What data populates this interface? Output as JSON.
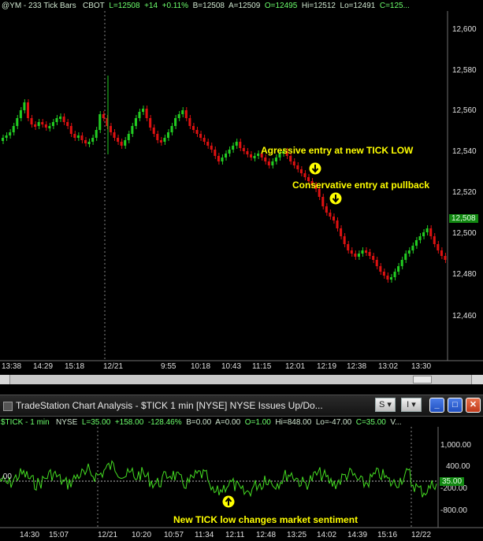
{
  "main_chart": {
    "info_bar": {
      "symbol": "@YM - 233 Tick Bars",
      "exchange": "CBOT",
      "last": "L=12508",
      "change": "+14",
      "pct": "+0.11%",
      "bid": "B=12508",
      "ask": "A=12509",
      "open": "O=12495",
      "high": "Hi=12512",
      "low": "Lo=12491",
      "close": "C=125..."
    },
    "y_axis_labels": [
      "12,600",
      "12,580",
      "12,560",
      "12,540",
      "12,520",
      "12,500",
      "12,480",
      "12,460"
    ],
    "x_axis_labels": [
      "13:38",
      "14:29",
      "15:18",
      "12/21",
      "9:55",
      "10:18",
      "10:43",
      "11:15",
      "12:01",
      "12:19",
      "12:38",
      "13:02",
      "13:30"
    ],
    "last_price_tag": "12,508",
    "annotations": {
      "aggressive": "Agressive entry at new TICK LOW",
      "conservative": "Conservative entry at pullback"
    },
    "colors": {
      "up": "#22cc22",
      "down": "#dd1111"
    }
  },
  "tick_panel": {
    "window_title": "TradeStation Chart Analysis - $TICK  1 min  [NYSE] NYSE Issues Up/Do...",
    "toolbar": {
      "s_button": "S",
      "i_button": "I"
    },
    "info_bar": {
      "symbol": "$TICK - 1 min",
      "exchange": "NYSE",
      "last": "L=35.00",
      "change": "+158.00",
      "pct": "-128.46%",
      "bid": "B=0.00",
      "ask": "A=0.00",
      "open": "O=1.00",
      "high": "Hi=848.00",
      "low": "Lo=-47.00",
      "close": "C=35.00",
      "more": "V..."
    },
    "y_axis_labels": [
      "1,000.00",
      "400.00",
      "-200.00",
      "-800.00"
    ],
    "left_label": ".00",
    "last_value_tag": "35.00",
    "x_axis_labels": [
      "14:30",
      "15:07",
      "12/21",
      "10:20",
      "10:57",
      "11:34",
      "12:11",
      "12:48",
      "13:25",
      "14:02",
      "14:39",
      "15:16",
      "12/22"
    ],
    "annotation": "New TICK low changes market sentiment",
    "line_color": "#44dd22"
  }
}
